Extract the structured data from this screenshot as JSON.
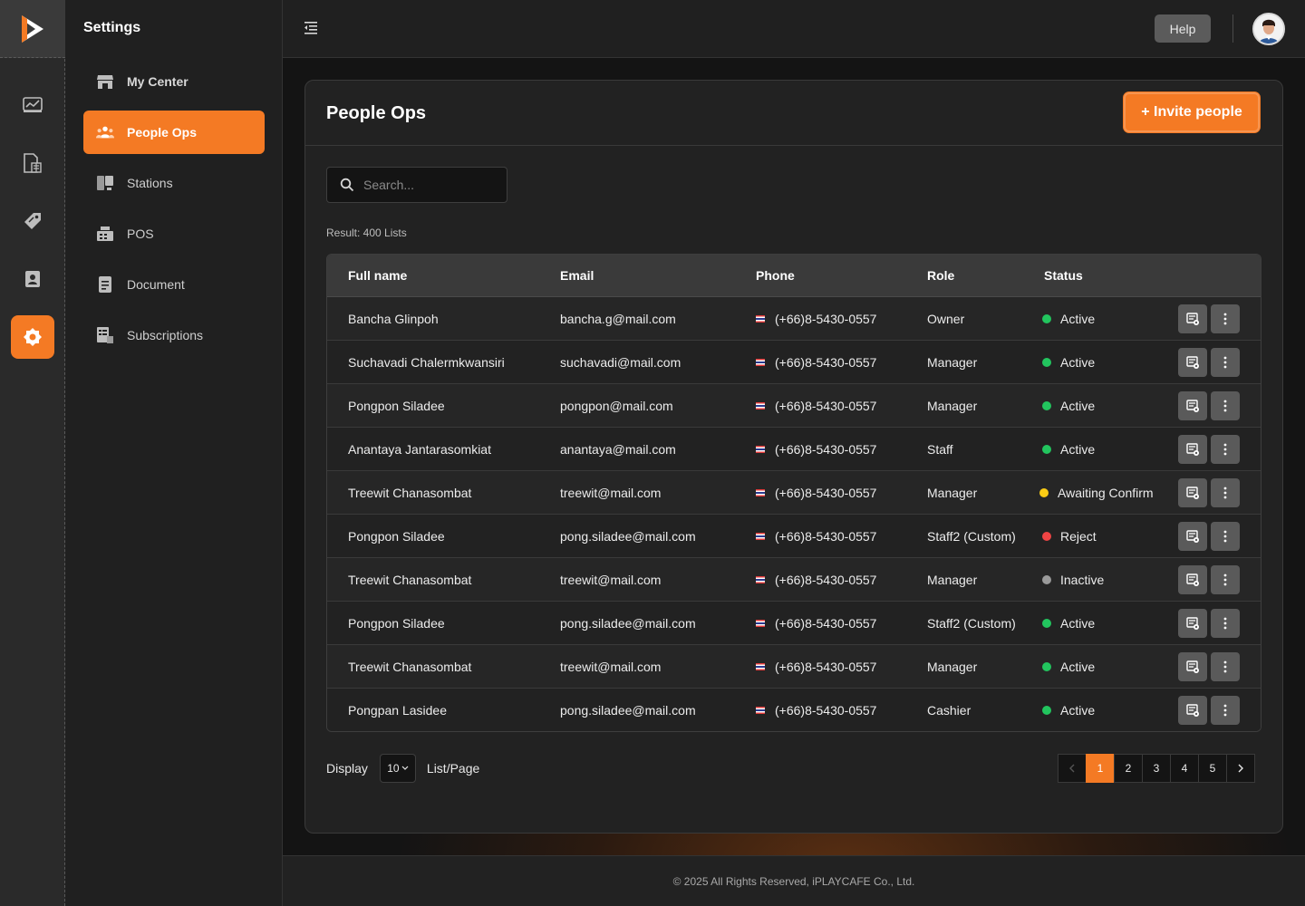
{
  "sidebar": {
    "title": "Settings",
    "items": [
      {
        "label": "My Center",
        "icon": "store-icon"
      },
      {
        "label": "People Ops",
        "icon": "people-icon"
      },
      {
        "label": "Stations",
        "icon": "station-icon"
      },
      {
        "label": "POS",
        "icon": "pos-icon"
      },
      {
        "label": "Document",
        "icon": "document-icon"
      },
      {
        "label": "Subscriptions",
        "icon": "subscription-icon"
      }
    ]
  },
  "topbar": {
    "help_label": "Help"
  },
  "page": {
    "title": "People Ops",
    "invite_label": "+ Invite people",
    "search_placeholder": "Search...",
    "result_text": "Result: 400 Lists"
  },
  "table": {
    "headers": [
      "Full name",
      "Email",
      "Phone",
      "Role",
      "Status"
    ],
    "rows": [
      {
        "name": "Bancha Glinpoh",
        "email": "bancha.g@mail.com",
        "phone": "(+66)8-5430-0557",
        "role": "Owner",
        "status": "Active"
      },
      {
        "name": "Suchavadi Chalermkwansiri",
        "email": "suchavadi@mail.com",
        "phone": "(+66)8-5430-0557",
        "role": "Manager",
        "status": "Active"
      },
      {
        "name": "Pongpon Siladee",
        "email": "pongpon@mail.com",
        "phone": "(+66)8-5430-0557",
        "role": "Manager",
        "status": "Active"
      },
      {
        "name": "Anantaya Jantarasomkiat",
        "email": "anantaya@mail.com",
        "phone": "(+66)8-5430-0557",
        "role": "Staff",
        "status": "Active"
      },
      {
        "name": "Treewit Chanasombat",
        "email": "treewit@mail.com",
        "phone": "(+66)8-5430-0557",
        "role": "Manager",
        "status": "Awaiting Confirm"
      },
      {
        "name": "Pongpon Siladee",
        "email": "pong.siladee@mail.com",
        "phone": "(+66)8-5430-0557",
        "role": "Staff2 (Custom)",
        "status": "Reject"
      },
      {
        "name": "Treewit Chanasombat",
        "email": "treewit@mail.com",
        "phone": "(+66)8-5430-0557",
        "role": "Manager",
        "status": "Inactive"
      },
      {
        "name": "Pongpon Siladee",
        "email": "pong.siladee@mail.com",
        "phone": "(+66)8-5430-0557",
        "role": "Staff2 (Custom)",
        "status": "Active"
      },
      {
        "name": "Treewit Chanasombat",
        "email": "treewit@mail.com",
        "phone": "(+66)8-5430-0557",
        "role": "Manager",
        "status": "Active"
      },
      {
        "name": "Pongpan Lasidee",
        "email": "pong.siladee@mail.com",
        "phone": "(+66)8-5430-0557",
        "role": "Cashier",
        "status": "Active"
      }
    ]
  },
  "status_colors": {
    "Active": "#22c55e",
    "Awaiting Confirm": "#facc15",
    "Reject": "#ef4444",
    "Inactive": "#9a9a9a"
  },
  "pagination": {
    "display_label": "Display",
    "per_page_value": "10",
    "per_page_suffix": "List/Page",
    "pages": [
      "1",
      "2",
      "3",
      "4",
      "5"
    ],
    "current_page": "1"
  },
  "footer": {
    "text": "© 2025 All Rights Reserved, iPLAYCAFE Co., Ltd."
  },
  "theme": {
    "accent": "#f47a24"
  }
}
